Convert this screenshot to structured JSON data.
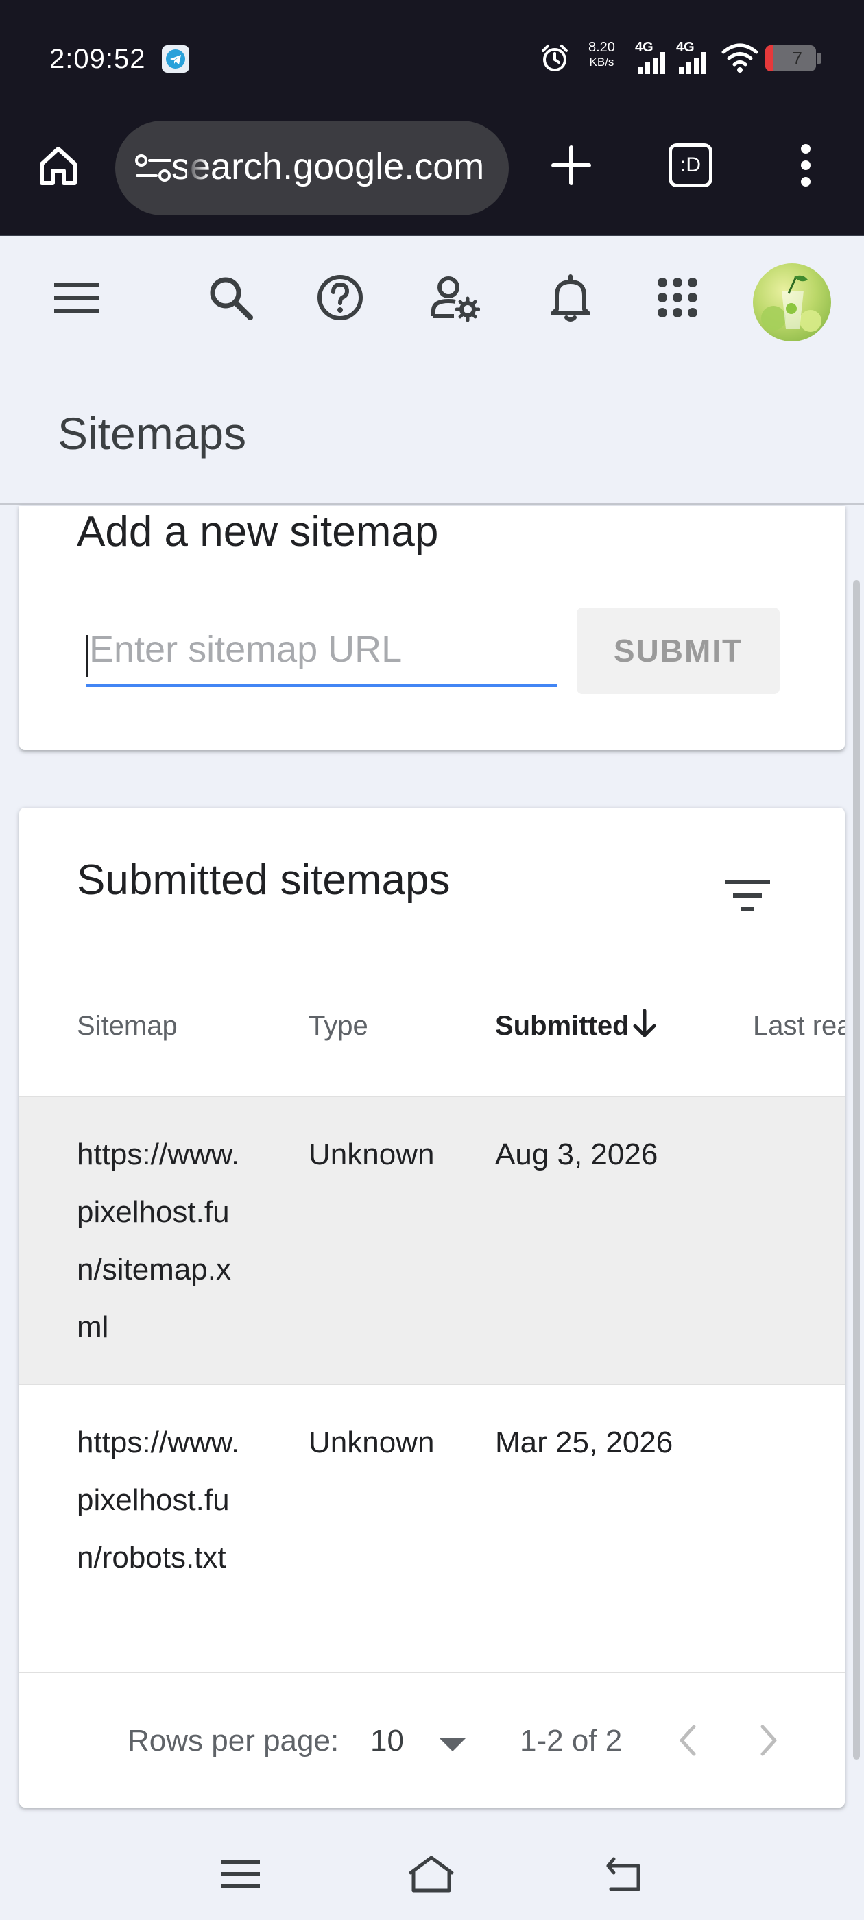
{
  "status_bar": {
    "time": "2:09:52",
    "net_speed_value": "8.20",
    "net_speed_unit": "KB/s",
    "network_1": "4G",
    "network_2": "4G",
    "battery": "7"
  },
  "browser": {
    "url": "search.google.com",
    "icons": [
      "home-icon",
      "site-settings-icon",
      "new-tab-icon",
      "tab-switcher-icon",
      "more-vert-icon"
    ],
    "tab_switcher_label": ":D"
  },
  "header": {
    "icons": [
      "menu-icon",
      "search-icon",
      "help-icon",
      "manage-users-icon",
      "notifications-icon",
      "apps-icon"
    ],
    "page_title": "Sitemaps"
  },
  "add_sitemap": {
    "title": "Add a new sitemap",
    "input_placeholder": "Enter sitemap URL",
    "input_value": "",
    "submit_label": "SUBMIT"
  },
  "submitted": {
    "title": "Submitted sitemaps",
    "columns": [
      "Sitemap",
      "Type",
      "Submitted",
      "Last read"
    ],
    "sorted_column": "Submitted",
    "sort_direction": "descending",
    "rows": [
      {
        "sitemap": "https://www.pixelhost.fun/sitemap.xml",
        "type": "Unknown",
        "submitted": "Aug 3, 2026"
      },
      {
        "sitemap": "https://www.pixelhost.fun/robots.txt",
        "type": "Unknown",
        "submitted": "Mar 25, 2026"
      }
    ],
    "pagination": {
      "rows_per_page_label": "Rows per page:",
      "rows_per_page": "10",
      "range": "1-2 of 2"
    }
  },
  "colors": {
    "status_bar_bg": "#171621",
    "page_bg": "#eef1f8",
    "input_underline": "#4285f4",
    "hover_row": "#eeeeee"
  }
}
